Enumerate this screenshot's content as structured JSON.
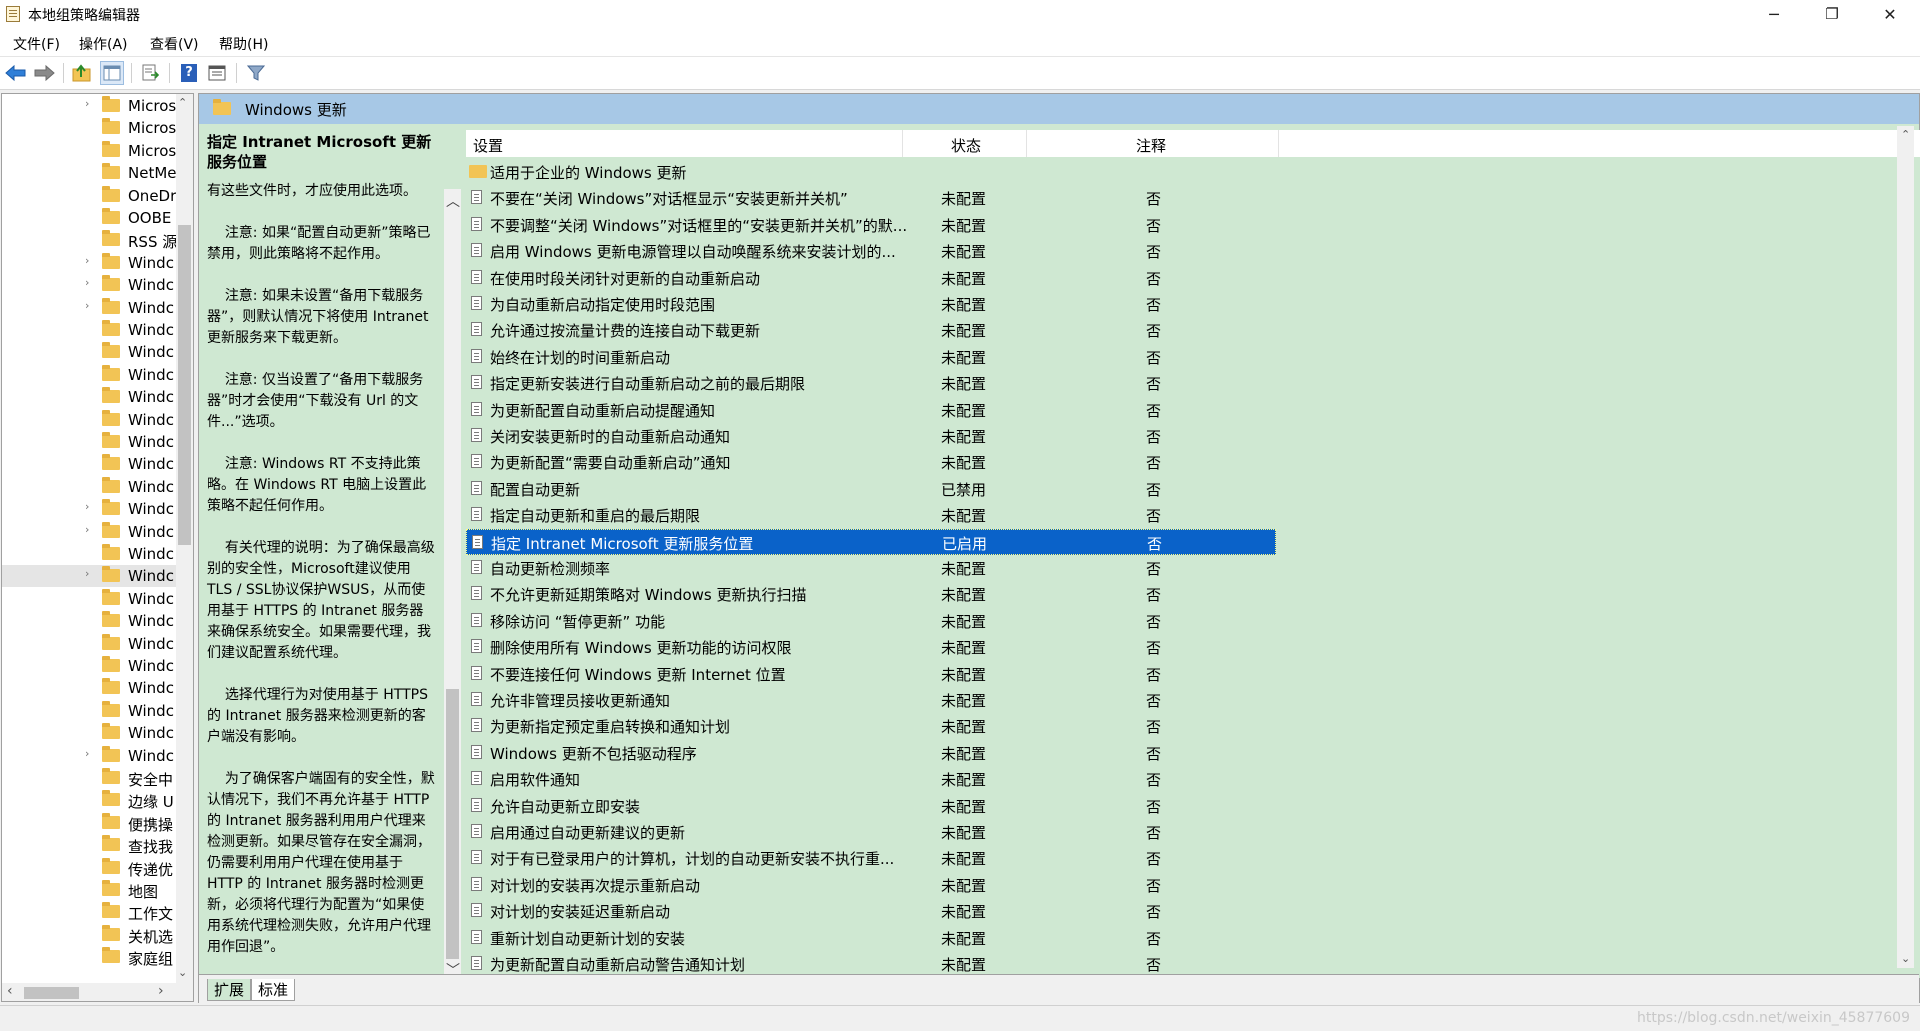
{
  "window": {
    "title": "本地组策略编辑器",
    "minimize_glyph": "─",
    "restore_glyph": "❐",
    "close_glyph": "✕"
  },
  "menu": [
    "文件(F)",
    "操作(A)",
    "查看(V)",
    "帮助(H)"
  ],
  "toolbar": {
    "back_icon": "back-arrow-icon",
    "forward_icon": "forward-arrow-icon",
    "up_icon": "up-folder-icon",
    "show_hide_tree_icon": "console-tree-icon",
    "export_icon": "export-list-icon",
    "help_icon": "help-icon",
    "help_glyph": "?",
    "properties_icon": "properties-icon",
    "filter_icon": "filter-icon"
  },
  "tree": {
    "items": [
      {
        "label": "Micros",
        "arrow": "›"
      },
      {
        "label": "Micros",
        "arrow": ""
      },
      {
        "label": "Micros",
        "arrow": ""
      },
      {
        "label": "NetMe",
        "arrow": ""
      },
      {
        "label": "OneDr",
        "arrow": ""
      },
      {
        "label": "OOBE",
        "arrow": ""
      },
      {
        "label": "RSS 源",
        "arrow": ""
      },
      {
        "label": "Windc",
        "arrow": "›"
      },
      {
        "label": "Windc",
        "arrow": "›"
      },
      {
        "label": "Windc",
        "arrow": "›"
      },
      {
        "label": "Windc",
        "arrow": ""
      },
      {
        "label": "Windc",
        "arrow": ""
      },
      {
        "label": "Windc",
        "arrow": ""
      },
      {
        "label": "Windc",
        "arrow": ""
      },
      {
        "label": "Windc",
        "arrow": ""
      },
      {
        "label": "Windc",
        "arrow": ""
      },
      {
        "label": "Windc",
        "arrow": ""
      },
      {
        "label": "Windc",
        "arrow": ""
      },
      {
        "label": "Windc",
        "arrow": "›"
      },
      {
        "label": "Windc",
        "arrow": "›"
      },
      {
        "label": "Windc",
        "arrow": ""
      },
      {
        "label": "Windc",
        "arrow": "›",
        "selected": true
      },
      {
        "label": "Windc",
        "arrow": ""
      },
      {
        "label": "Windc",
        "arrow": ""
      },
      {
        "label": "Windc",
        "arrow": ""
      },
      {
        "label": "Windc",
        "arrow": ""
      },
      {
        "label": "Windc",
        "arrow": ""
      },
      {
        "label": "Windc",
        "arrow": ""
      },
      {
        "label": "Windc",
        "arrow": ""
      },
      {
        "label": "Windc",
        "arrow": "›"
      },
      {
        "label": "安全中",
        "arrow": ""
      },
      {
        "label": "边缘 U",
        "arrow": ""
      },
      {
        "label": "便携操",
        "arrow": ""
      },
      {
        "label": "查找我",
        "arrow": ""
      },
      {
        "label": "传递优",
        "arrow": ""
      },
      {
        "label": "地图",
        "arrow": ""
      },
      {
        "label": "工作文",
        "arrow": ""
      },
      {
        "label": "关机选",
        "arrow": ""
      },
      {
        "label": "家庭组",
        "arrow": ""
      }
    ],
    "scroll_up": "⌃",
    "scroll_down": "⌄",
    "scroll_left": "‹",
    "scroll_right": "›"
  },
  "panel": {
    "header_title": "Windows 更新",
    "description": {
      "title": "指定 Intranet Microsoft 更新服务位置",
      "body": "有这些文件时，才应使用此选项。\n\n    注意: 如果“配置自动更新”策略已禁用，则此策略将不起作用。\n\n    注意: 如果未设置“备用下载服务器”，则默认情况下将使用 Intranet 更新服务来下载更新。\n\n    注意: 仅当设置了“备用下载服务器”时才会使用“下载没有 Url 的文件...”选项。\n\n    注意: Windows RT 不支持此策略。在 Windows RT 电脑上设置此策略不起任何作用。\n\n    有关代理的说明：为了确保最高级别的安全性，Microsoft建议使用TLS / SSL协议保护WSUS，从而使用基于 HTTPS 的 Intranet 服务器来确保系统安全。如果需要代理，我们建议配置系统代理。\n\n    选择代理行为对使用基于 HTTPS 的 Intranet 服务器来检测更新的客户端没有影响。\n\n    为了确保客户端固有的安全性，默认情况下，我们不再允许基于 HTTP 的 Intranet 服务器利用用户代理来检测更新。如果尽管存在安全漏洞，仍需要利用用户代理在使用基于 HTTP 的 Intranet 服务器时检测更新，必须将代理行为配置为“如果使用系统代理检测失败，允许用户代理用作回退”。",
      "scroll_up": "︿",
      "scroll_down": "﹀"
    },
    "columns": {
      "setting": "设置",
      "state": "状态",
      "note": "注释"
    },
    "rows": [
      {
        "name": "适用于企业的 Windows 更新",
        "state": "",
        "note": "",
        "type": "folder"
      },
      {
        "name": "不要在“关闭 Windows”对话框显示“安装更新并关机”",
        "state": "未配置",
        "note": "否"
      },
      {
        "name": "不要调整“关闭 Windows”对话框里的“安装更新并关机”的默...",
        "state": "未配置",
        "note": "否"
      },
      {
        "name": "启用 Windows 更新电源管理以自动唤醒系统来安装计划的...",
        "state": "未配置",
        "note": "否"
      },
      {
        "name": "在使用时段关闭针对更新的自动重新启动",
        "state": "未配置",
        "note": "否"
      },
      {
        "name": "为自动重新启动指定使用时段范围",
        "state": "未配置",
        "note": "否"
      },
      {
        "name": "允许通过按流量计费的连接自动下载更新",
        "state": "未配置",
        "note": "否"
      },
      {
        "name": "始终在计划的时间重新启动",
        "state": "未配置",
        "note": "否"
      },
      {
        "name": "指定更新安装进行自动重新启动之前的最后期限",
        "state": "未配置",
        "note": "否"
      },
      {
        "name": "为更新配置自动重新启动提醒通知",
        "state": "未配置",
        "note": "否"
      },
      {
        "name": "关闭安装更新时的自动重新启动通知",
        "state": "未配置",
        "note": "否"
      },
      {
        "name": "为更新配置“需要自动重新启动”通知",
        "state": "未配置",
        "note": "否"
      },
      {
        "name": "配置自动更新",
        "state": "已禁用",
        "note": "否"
      },
      {
        "name": "指定自动更新和重启的最后期限",
        "state": "未配置",
        "note": "否"
      },
      {
        "name": "指定 Intranet Microsoft 更新服务位置",
        "state": "已启用",
        "note": "否",
        "selected": true
      },
      {
        "name": "自动更新检测频率",
        "state": "未配置",
        "note": "否"
      },
      {
        "name": "不允许更新延期策略对 Windows 更新执行扫描",
        "state": "未配置",
        "note": "否"
      },
      {
        "name": "移除访问 “暂停更新” 功能",
        "state": "未配置",
        "note": "否"
      },
      {
        "name": "删除使用所有 Windows 更新功能的访问权限",
        "state": "未配置",
        "note": "否"
      },
      {
        "name": "不要连接任何 Windows 更新 Internet 位置",
        "state": "未配置",
        "note": "否"
      },
      {
        "name": "允许非管理员接收更新通知",
        "state": "未配置",
        "note": "否"
      },
      {
        "name": "为更新指定预定重启转换和通知计划",
        "state": "未配置",
        "note": "否"
      },
      {
        "name": "Windows 更新不包括驱动程序",
        "state": "未配置",
        "note": "否"
      },
      {
        "name": "启用软件通知",
        "state": "未配置",
        "note": "否"
      },
      {
        "name": "允许自动更新立即安装",
        "state": "未配置",
        "note": "否"
      },
      {
        "name": "启用通过自动更新建议的更新",
        "state": "未配置",
        "note": "否"
      },
      {
        "name": "对于有已登录用户的计算机，计划的自动更新安装不执行重...",
        "state": "未配置",
        "note": "否"
      },
      {
        "name": "对计划的安装再次提示重新启动",
        "state": "未配置",
        "note": "否"
      },
      {
        "name": "对计划的安装延迟重新启动",
        "state": "未配置",
        "note": "否"
      },
      {
        "name": "重新计划自动更新计划的安装",
        "state": "未配置",
        "note": "否"
      },
      {
        "name": "为更新配置自动重新启动警告通知计划",
        "state": "未配置",
        "note": "否"
      }
    ],
    "list_scroll_up": "⌃",
    "list_scroll_down": "⌄",
    "tabs": [
      "扩展",
      "标准"
    ]
  },
  "statusbar": {
    "watermark": "https://blog.csdn.net/weixin_45877609"
  }
}
